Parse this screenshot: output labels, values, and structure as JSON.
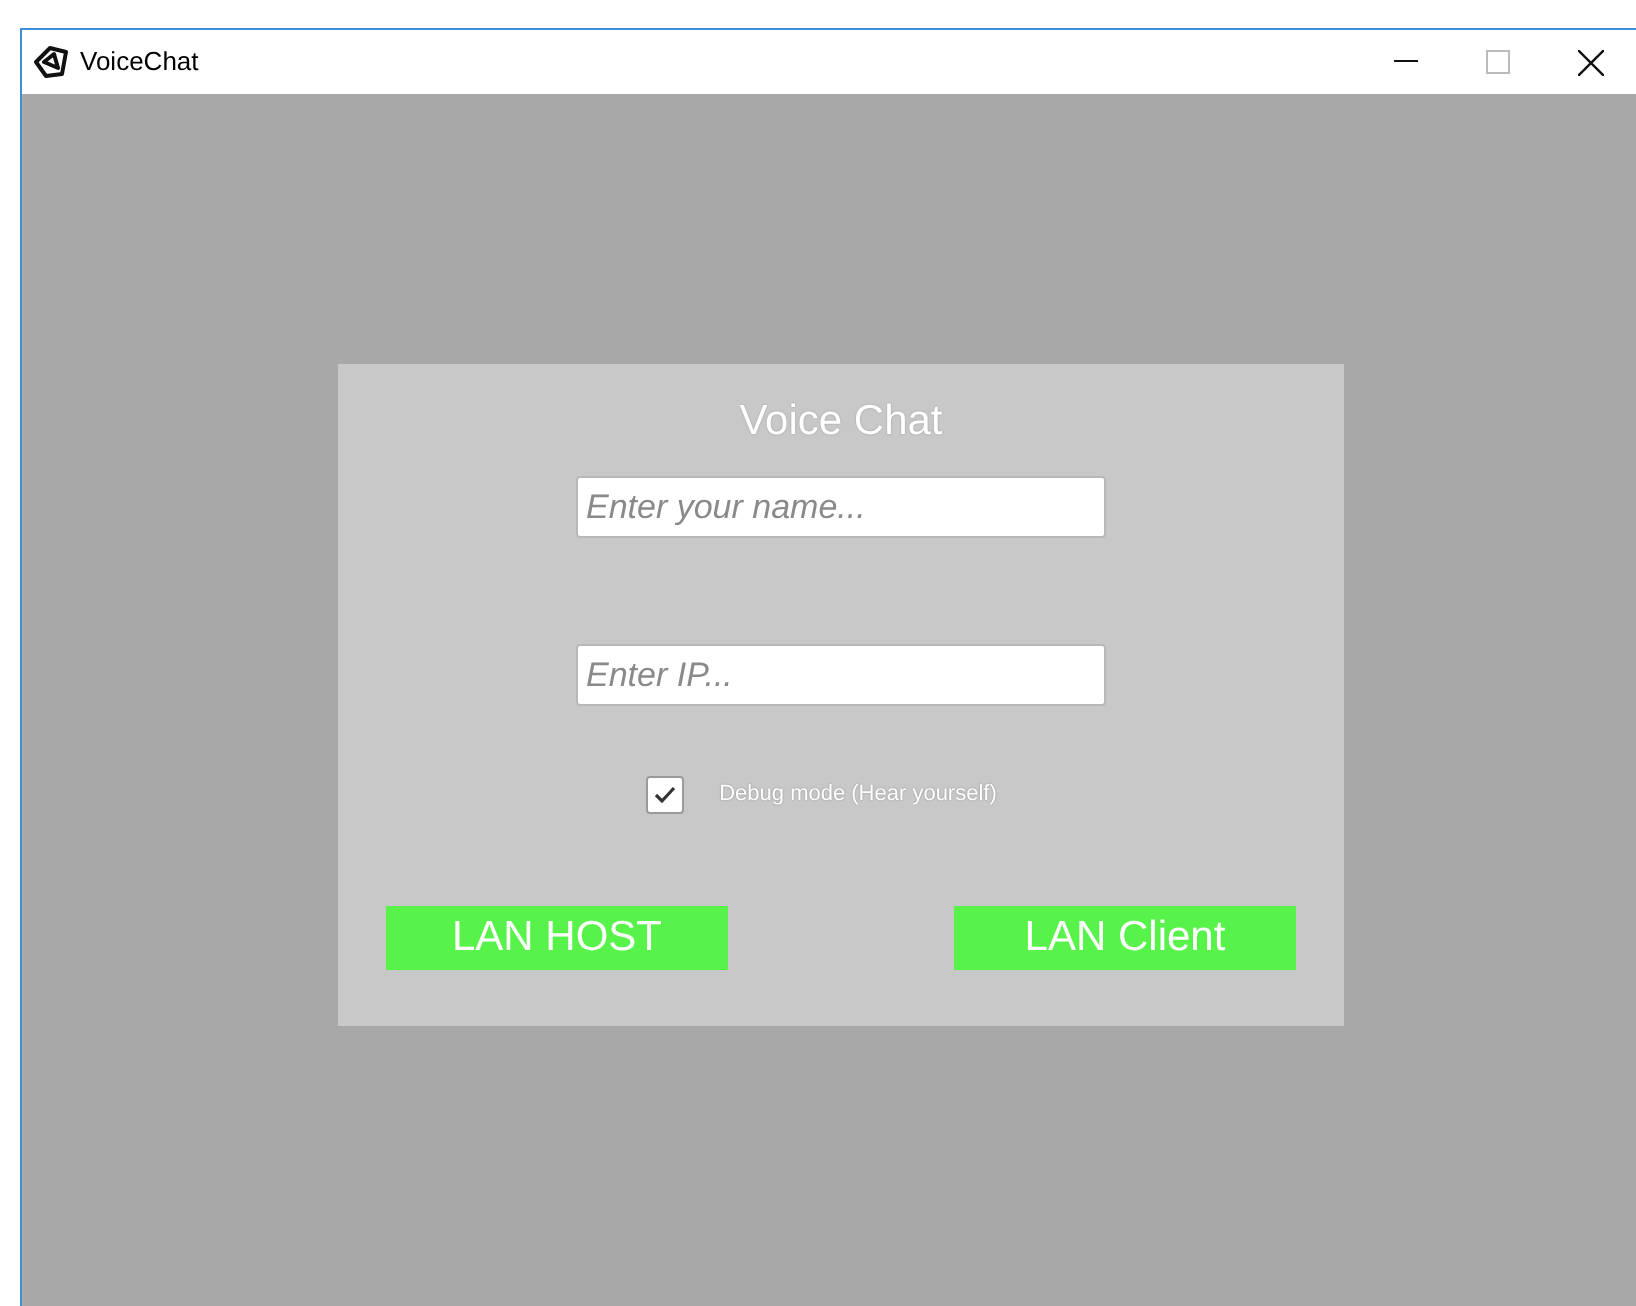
{
  "window": {
    "title": "VoiceChat"
  },
  "panel": {
    "title": "Voice Chat",
    "fields": [
      {
        "placeholder": "Enter your name..."
      },
      {
        "placeholder": "Enter IP..."
      }
    ],
    "debug": {
      "label": "Debug mode (Hear yourself)",
      "checked": true
    },
    "buttons": [
      "LAN HOST",
      "LAN Client"
    ]
  }
}
